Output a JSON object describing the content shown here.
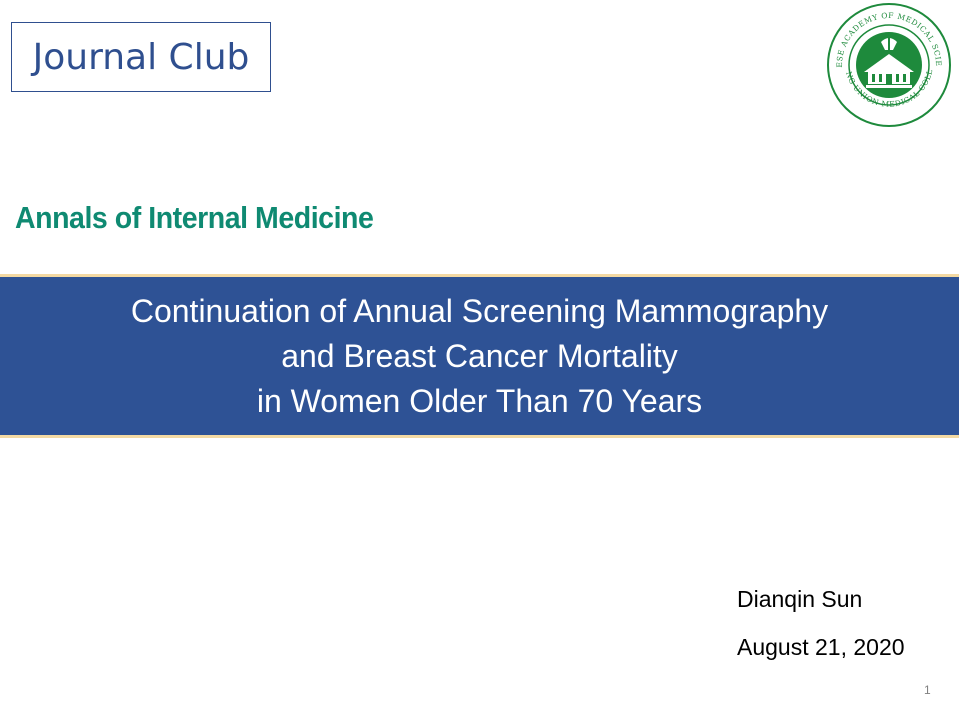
{
  "slide": {
    "header_box": "Journal Club",
    "journal_name": "Annals of Internal Medicine",
    "title_lines": [
      "Continuation of Annual Screening Mammography",
      "and Breast Cancer Mortality",
      "in Women Older Than 70 Years"
    ],
    "author": "Dianqin Sun",
    "date": "August 21, 2020",
    "page_number": "1"
  },
  "seal": {
    "outer_text": "CHINESE ACADEMY OF MEDICAL SCIENCES",
    "inner_text": "PEKING UNION MEDICAL COLLEGE",
    "icon": "institution-seal-icon"
  },
  "colors": {
    "accent_blue": "#2e5295",
    "club_border": "#2f4f8f",
    "journal_green": "#0f8a72",
    "band_rule": "#f3d9a3",
    "seal_green": "#1e8a3c"
  }
}
